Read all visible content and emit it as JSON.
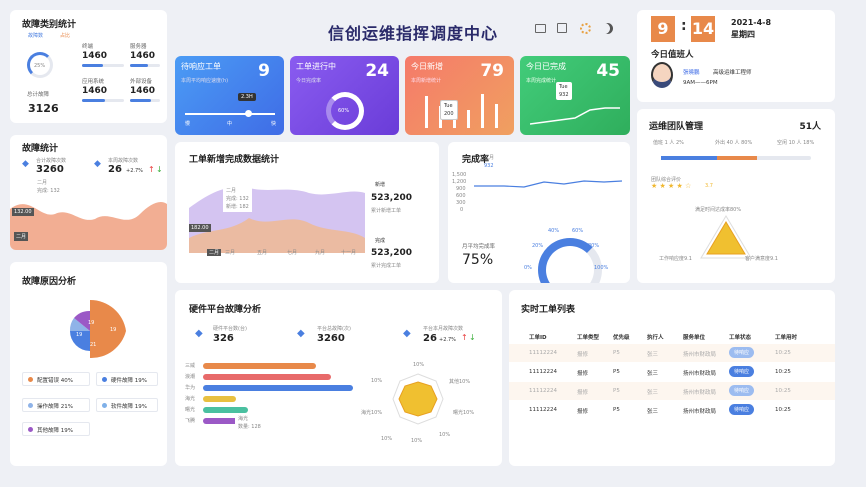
{
  "header": {
    "title": "信创运维指挥调度中心"
  },
  "clock": {
    "h": "9",
    "sep": ":",
    "m": "14",
    "date": "2021-4-8",
    "weekday": "星期四"
  },
  "duty": {
    "title": "今日值班人",
    "name": "張曉鵬",
    "role": "高级运维工程师",
    "time": "9AM——6PM"
  },
  "fault_cat": {
    "title": "故障类别统计",
    "legend": [
      "故障数",
      "占比"
    ],
    "pct": "25%",
    "total_label": "总计故障",
    "total": "3126",
    "items": [
      {
        "name": "终端",
        "value": "1460"
      },
      {
        "name": "服务器",
        "value": "1460"
      },
      {
        "name": "应用系统",
        "value": "1460"
      },
      {
        "name": "外部设备",
        "value": "1460"
      }
    ]
  },
  "kpi": [
    {
      "title": "待响应工单",
      "sub": "本周平均响应速度(h)",
      "value": "9",
      "tip": "2.3H",
      "scale": [
        "慢",
        "中",
        "快"
      ]
    },
    {
      "title": "工单进行中",
      "sub": "今日完成率",
      "value": "24",
      "pct": "60%"
    },
    {
      "title": "今日新增",
      "sub": "本周新增统计",
      "value": "79",
      "tip1": "Tue",
      "tip2": "200"
    },
    {
      "title": "今日已完成",
      "sub": "本周完成统计",
      "value": "45",
      "tip1": "Tue",
      "tip2": "932"
    }
  ],
  "team": {
    "title": "运维团队管理",
    "count": "51人",
    "legend": [
      "值班 1 人 2%",
      "外出 40 人 80%",
      "空闲 10 人 18%"
    ],
    "rating_label": "团队综合评价",
    "rating": "3.7",
    "radar": [
      "满足时间达成率80%",
      "工作响应度9.1",
      "客户满意度9.1"
    ]
  },
  "fault_stat": {
    "title": "故障统计",
    "total_label": "合计故障次数",
    "total": "3260",
    "week_label": "本周故障次数",
    "week": "26",
    "change": "+2.7%",
    "tip_title": "二月",
    "tip_item": "完成: 132",
    "axis_val": "132.00",
    "axis_month": "二月"
  },
  "trend": {
    "title": "工单新增完成数据统计",
    "tip_title": "二月",
    "tip_a": "完成: 132",
    "tip_b": "新增: 182",
    "axis_val": "182.00",
    "xlabels": [
      "二月",
      "三月",
      "五月",
      "七月",
      "九月",
      "十一月"
    ],
    "new_label": "新增",
    "new_value": "523,200",
    "new_sub": "累计新增工单",
    "done_label": "完成",
    "done_value": "523,200",
    "done_sub": "累计完成工单"
  },
  "completion": {
    "title": "完成率",
    "tip_title": "二月",
    "tip_val": "932",
    "yticks": [
      "1,500",
      "1,200",
      "900",
      "600",
      "300",
      "0"
    ],
    "avg_label": "月平均完成率",
    "avg": "75%",
    "gauge": [
      "0%",
      "20%",
      "40%",
      "60%",
      "80%",
      "100%"
    ]
  },
  "fault_cause": {
    "title": "故障原因分析",
    "slices": [
      "19",
      "19",
      "21",
      "19"
    ],
    "legend": [
      {
        "label": "配置错误 40%",
        "color": "#e8894a"
      },
      {
        "label": "硬件故障 19%",
        "color": "#4a7fe0"
      },
      {
        "label": "操作故障 21%",
        "color": "#8fb3e8"
      },
      {
        "label": "软件故障 19%",
        "color": "#7fb0e8"
      },
      {
        "label": "其他故障 19%",
        "color": "#9b59c6"
      }
    ]
  },
  "hw": {
    "title": "硬件平台故障分析",
    "a_label": "硬件平台数(台)",
    "a": "326",
    "b_label": "平台总故障(次)",
    "b": "3260",
    "c_label": "平台本月故障次数",
    "c": "26",
    "change": "+2.7%",
    "bars": [
      {
        "label": "三威",
        "w": 0.75,
        "color": "#e8894a"
      },
      {
        "label": "浪潮",
        "w": 0.85,
        "color": "#e86a6a"
      },
      {
        "label": "华为",
        "w": 1.0,
        "color": "#4a7fe0"
      },
      {
        "label": "海光",
        "w": 0.22,
        "color": "#e8c040"
      },
      {
        "label": "曙光",
        "w": 0.3,
        "color": "#4ac0a0"
      },
      {
        "label": "飞腾",
        "w": 0.28,
        "color": "#9b59c6"
      }
    ],
    "tip_name": "海光",
    "tip_val": "数量: 128",
    "radar": [
      "10%",
      "10%",
      "其他10%",
      "曙光10%",
      "10%",
      "10%",
      "海光10%",
      "10%"
    ]
  },
  "orders": {
    "title": "实时工单列表",
    "head": [
      "工单ID",
      "工单类型",
      "优先级",
      "执行人",
      "服务单位",
      "工单状态",
      "工单用时"
    ],
    "rows": [
      [
        "11112224",
        "报修",
        "P5",
        "张三",
        "扬州市财政局",
        "待响应",
        "10:25"
      ],
      [
        "11112224",
        "报修",
        "P5",
        "张三",
        "扬州市财政局",
        "待响应",
        "10:25"
      ],
      [
        "11112224",
        "报修",
        "P5",
        "张三",
        "扬州市财政局",
        "待响应",
        "10:25"
      ],
      [
        "11112224",
        "报修",
        "P5",
        "张三",
        "扬州市财政局",
        "待响应",
        "10:25"
      ]
    ]
  }
}
